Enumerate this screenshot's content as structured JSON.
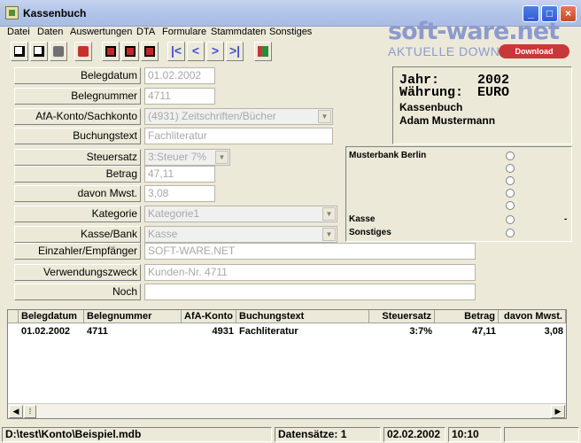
{
  "window": {
    "title": "Kassenbuch"
  },
  "menu": [
    "Datei",
    "Daten",
    "Auswertungen",
    "DTA",
    "Formulare",
    "Stammdaten",
    "Sonstiges"
  ],
  "watermark": {
    "logo": "soft-ware.net",
    "subtitle": "AKTUELLE DOWNLOADS",
    "badge": "Download"
  },
  "toolbar": {
    "nav": [
      "|<",
      "<",
      ">",
      ">|"
    ],
    "icons": [
      "new-icon",
      "copy-icon",
      "delete-icon",
      "print-icon",
      "report-icon",
      "report-2-icon",
      "report-3-icon",
      "exit-icon"
    ]
  },
  "form": {
    "belegdatum": {
      "label": "Belegdatum",
      "value": "01.02.2002"
    },
    "belegnummer": {
      "label": "Belegnummer",
      "value": "4711"
    },
    "afa_konto": {
      "label": "AfA-Konto/Sachkonto",
      "value": "(4931) Zeitschriften/Bücher"
    },
    "buchungstext": {
      "label": "Buchungstext",
      "value": "Fachliteratur"
    },
    "steuersatz": {
      "label": "Steuersatz",
      "value": "3:Steuer 7%"
    },
    "betrag": {
      "label": "Betrag",
      "value": "47,11"
    },
    "mwst": {
      "label": "davon Mwst.",
      "value": "3,08"
    },
    "kategorie": {
      "label": "Kategorie",
      "value": "Kategorie1"
    },
    "kasse_bank": {
      "label": "Kasse/Bank",
      "value": "Kasse"
    },
    "einzahler": {
      "label": "Einzahler/Empfänger",
      "value": "SOFT-WARE.NET"
    },
    "verwendungszweck": {
      "label": "Verwendungszweck",
      "value": "Kunden-Nr. 4711"
    },
    "noch": {
      "label": "Noch",
      "value": ""
    }
  },
  "info": {
    "jahr_label": "Jahr:",
    "jahr": "2002",
    "waehrung_label": "Währung:",
    "waehrung": "EURO",
    "line3": "Kassenbuch",
    "line4": "Adam Mustermann"
  },
  "bank": {
    "first": "Musterbank Berlin",
    "kasse": "Kasse",
    "sonstiges": "Sonstiges",
    "kasse_extra": "-"
  },
  "table": {
    "headers": [
      "Belegdatum",
      "Belegnummer",
      "AfA-Konto",
      "Buchungstext",
      "Steuersatz",
      "Betrag",
      "davon Mwst."
    ],
    "rows": [
      [
        "01.02.2002",
        "4711",
        "4931",
        "Fachliteratur",
        "3:7%",
        "47,11",
        "3,08"
      ]
    ]
  },
  "status": {
    "path": "D:\\test\\Konto\\Beispiel.mdb",
    "records": "Datensätze: 1",
    "date": "02.02.2002",
    "time": "10:10"
  }
}
